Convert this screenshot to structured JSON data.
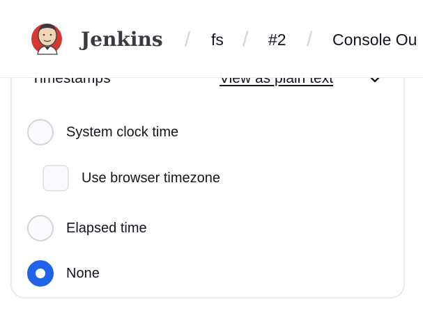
{
  "header": {
    "brand": "Jenkins",
    "breadcrumbs": [
      "fs",
      "#2",
      "Console Ou"
    ],
    "separator": "/"
  },
  "timestamps_panel": {
    "title": "Timestamps",
    "plain_text_link": "View as plain text",
    "options": [
      {
        "label": "System clock time",
        "type": "radio",
        "checked": false
      },
      {
        "label": "Use browser timezone",
        "type": "checkbox",
        "checked": false
      },
      {
        "label": "Elapsed time",
        "type": "radio",
        "checked": false
      },
      {
        "label": "None",
        "type": "radio",
        "checked": true
      }
    ]
  },
  "colors": {
    "accent": "#1f63e9",
    "border": "#e9e9ee",
    "text": "#14141f"
  }
}
